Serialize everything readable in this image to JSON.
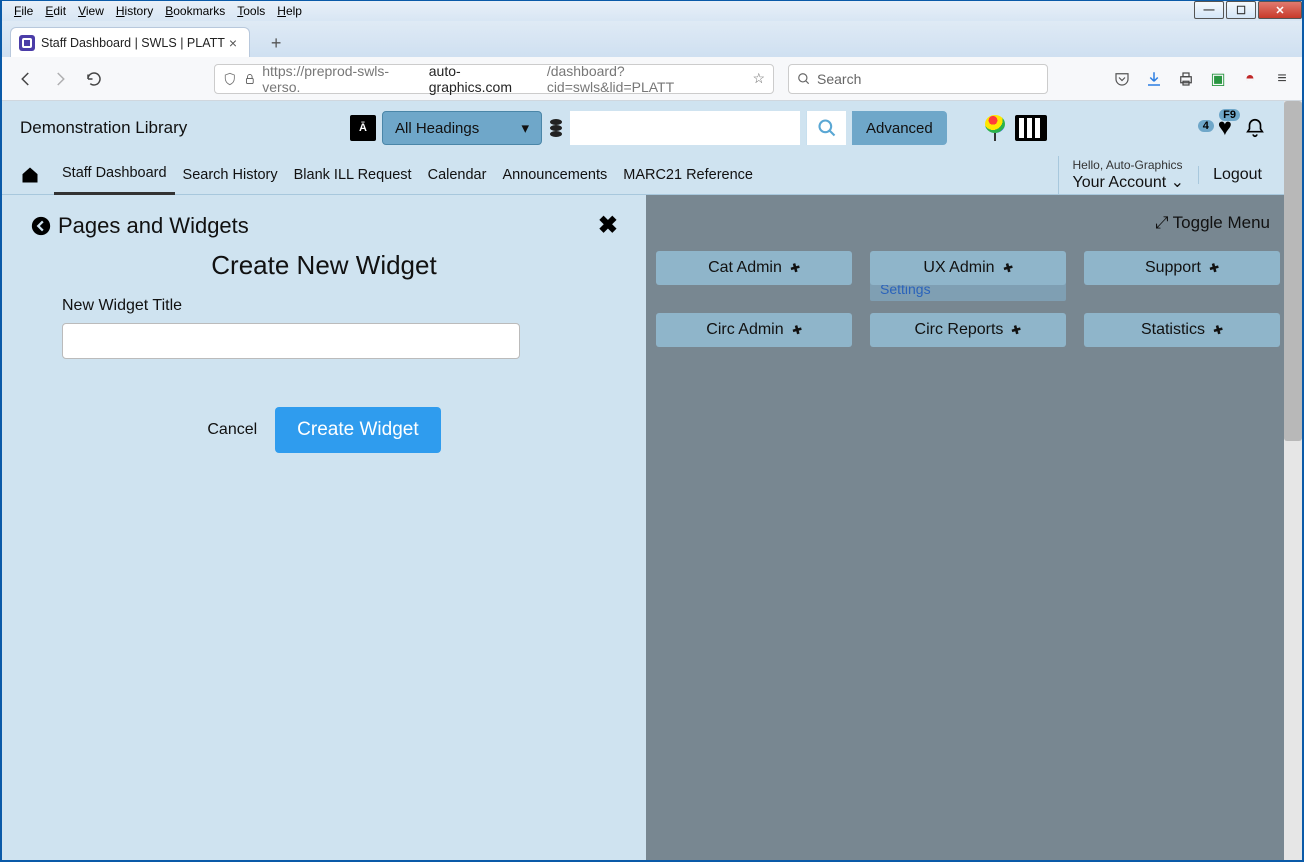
{
  "window_menu": [
    "File",
    "Edit",
    "View",
    "History",
    "Bookmarks",
    "Tools",
    "Help"
  ],
  "browser_tab": {
    "title": "Staff Dashboard | SWLS | PLATT"
  },
  "url_bar": {
    "prefix": "https://preprod-swls-verso.",
    "host": "auto-graphics.com",
    "path": "/dashboard?cid=swls&lid=PLATT"
  },
  "browser_search_placeholder": "Search",
  "app": {
    "library_name": "Demonstration Library",
    "search_filter": "All Headings",
    "advanced_label": "Advanced",
    "news_badge": "4",
    "heart_badge": "F9",
    "nav": {
      "staff_dashboard": "Staff Dashboard",
      "search_history": "Search History",
      "blank_ill": "Blank ILL Request",
      "calendar": "Calendar",
      "announcements": "Announcements",
      "marc21": "MARC21 Reference"
    },
    "account": {
      "hello": "Hello, Auto-Graphics",
      "your_account": "Your Account"
    },
    "logout": "Logout"
  },
  "panel": {
    "breadcrumb": "Pages and Widgets",
    "title": "Create New Widget",
    "field_label": "New Widget Title",
    "input_value": "",
    "cancel": "Cancel",
    "submit": "Create Widget"
  },
  "dashboard": {
    "toggle": "Toggle Menu",
    "cards": {
      "cat_admin": "Cat Admin",
      "ux_admin": "UX Admin",
      "support": "Support",
      "circ_admin": "Circ Admin",
      "statistics": "Statistics",
      "circ_reports": "Circ Reports",
      "settings": "Settings"
    }
  }
}
